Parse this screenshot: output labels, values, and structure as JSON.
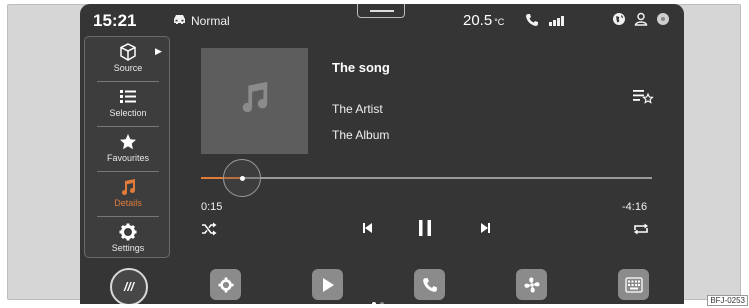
{
  "status": {
    "time": "15:21",
    "drive_mode": "Normal",
    "temperature": "20.5",
    "temperature_unit": "°C",
    "icons": [
      "car-icon",
      "phone-icon",
      "signal-icon",
      "globe-icon",
      "user-icon",
      "notification-icon"
    ]
  },
  "menu": {
    "items": [
      {
        "label": "Source",
        "icon": "box-icon"
      },
      {
        "label": "Selection",
        "icon": "list-icon"
      },
      {
        "label": "Favourites",
        "icon": "star-icon"
      },
      {
        "label": "Details",
        "icon": "music-note-icon",
        "active": true
      },
      {
        "label": "Settings",
        "icon": "gear-icon"
      }
    ]
  },
  "track": {
    "title": "The song",
    "artist": "The Artist",
    "album": "The Album",
    "elapsed": "0:15",
    "remaining": "-4:16",
    "progress_fraction": 0.09
  },
  "dock": {
    "home_label": "///",
    "buttons": [
      "gear-icon",
      "play-icon",
      "phone-icon",
      "fan-icon",
      "keyboard-icon"
    ]
  },
  "colors": {
    "accent": "#e07b39",
    "screen_bg": "#353535"
  },
  "reference": "BFJ-0253"
}
